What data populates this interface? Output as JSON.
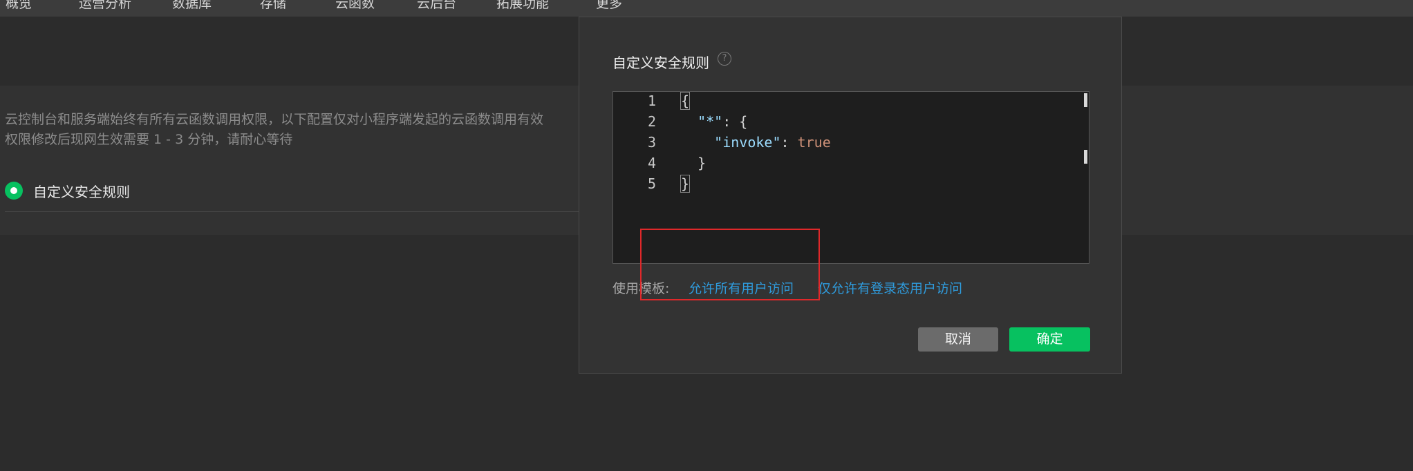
{
  "nav": {
    "items": [
      {
        "label": "概览",
        "id": "overview"
      },
      {
        "label": "运营分析",
        "id": "analytics"
      },
      {
        "label": "数据库",
        "id": "database"
      },
      {
        "label": "存储",
        "id": "storage"
      },
      {
        "label": "云函数",
        "id": "functions"
      },
      {
        "label": "云后台",
        "id": "backend"
      },
      {
        "label": "拓展功能",
        "id": "extensions"
      },
      {
        "label": "更多",
        "id": "more"
      }
    ]
  },
  "page": {
    "notice_line1": "云控制台和服务端始终有所有云函数调用权限，以下配置仅对小程序端发起的云函数调用有效",
    "notice_line2": "权限修改后现网生效需要 1 - 3 分钟，请耐心等待",
    "radio_label": "自定义安全规则"
  },
  "modal": {
    "title": "自定义安全规则",
    "help_icon": "question-circle-icon",
    "editor": {
      "line_numbers": [
        "1",
        "2",
        "3",
        "4",
        "5"
      ],
      "lines": [
        "{",
        "  \"*\": {",
        "    \"invoke\": true",
        "  }",
        "}"
      ]
    },
    "template_label": "使用模板:",
    "template_all_users": "允许所有用户访问",
    "template_logged_in": "仅允许有登录态用户访问",
    "cancel_label": "取消",
    "confirm_label": "确定"
  },
  "colors": {
    "accent_green": "#07c160",
    "link_blue": "#2f9bdc",
    "highlight_red": "#e0282a"
  }
}
